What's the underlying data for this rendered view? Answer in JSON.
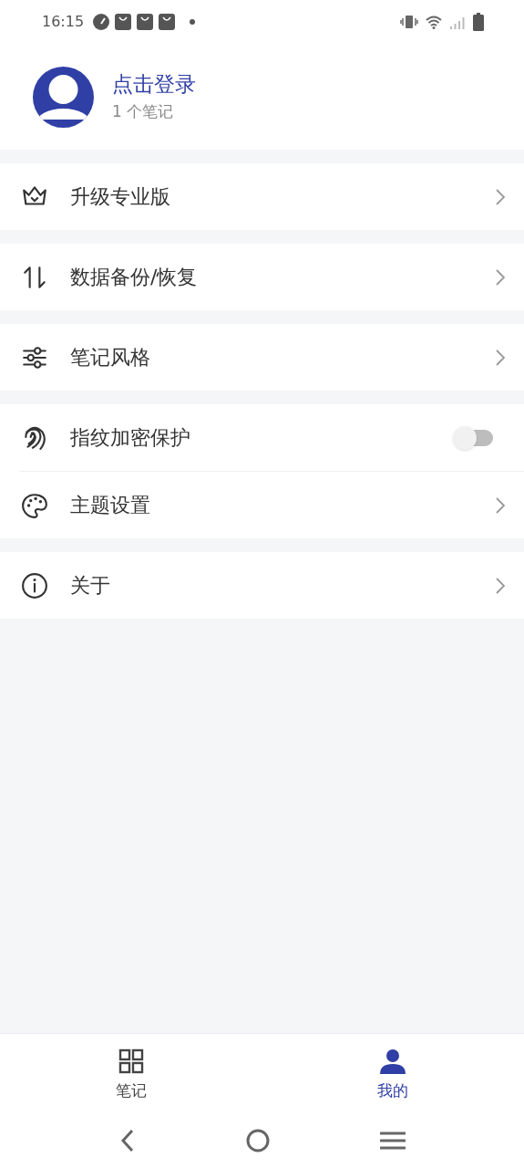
{
  "status_bar": {
    "time": "16:15"
  },
  "profile": {
    "title": "点击登录",
    "subtitle": "1 个笔记"
  },
  "menu_groups": [
    {
      "items": [
        {
          "label": "升级专业版",
          "kind": "link"
        }
      ]
    },
    {
      "items": [
        {
          "label": "数据备份/恢复",
          "kind": "link"
        }
      ]
    },
    {
      "items": [
        {
          "label": "笔记风格",
          "kind": "link"
        }
      ]
    },
    {
      "items": [
        {
          "label": "指纹加密保护",
          "kind": "toggle",
          "on": false
        },
        {
          "label": "主题设置",
          "kind": "link"
        }
      ]
    },
    {
      "items": [
        {
          "label": "关于",
          "kind": "link"
        }
      ]
    }
  ],
  "bottom_tabs": [
    {
      "label": "笔记",
      "selected": false
    },
    {
      "label": "我的",
      "selected": true
    }
  ]
}
